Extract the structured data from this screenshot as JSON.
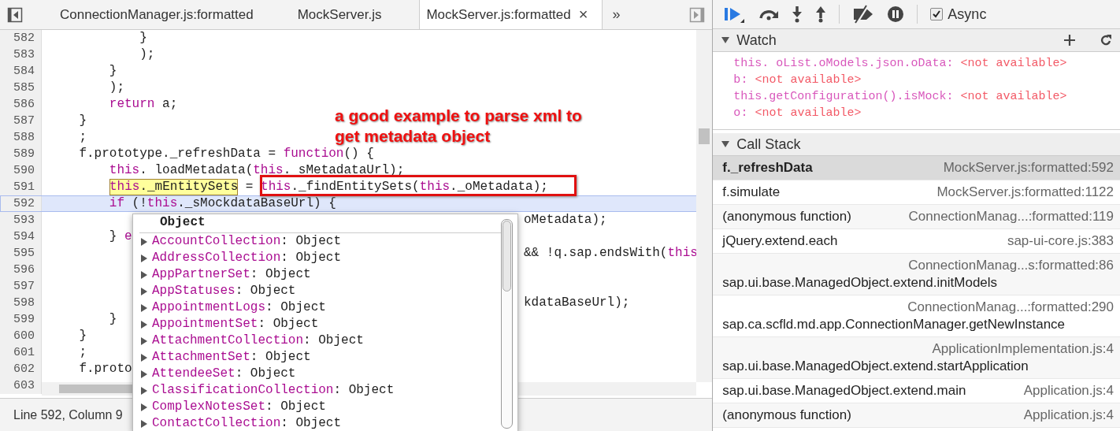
{
  "tabs": [
    {
      "label": "ConnectionManager.js:formatted",
      "selected": false
    },
    {
      "label": "MockServer.js",
      "selected": false
    },
    {
      "label": "MockServer.js:formatted",
      "selected": true,
      "close": "×"
    }
  ],
  "more_tabs": "»",
  "editor": {
    "lines": [
      {
        "num": "582",
        "selected": false,
        "segs": [
          {
            "t": "            }",
            "kind": "plain"
          }
        ]
      },
      {
        "num": "583",
        "selected": false,
        "segs": [
          {
            "t": "            );",
            "kind": "plain"
          }
        ]
      },
      {
        "num": "584",
        "selected": false,
        "segs": [
          {
            "t": "        }",
            "kind": "plain"
          }
        ]
      },
      {
        "num": "585",
        "selected": false,
        "segs": [
          {
            "t": "        );",
            "kind": "plain"
          }
        ]
      },
      {
        "num": "586",
        "selected": false,
        "segs": [
          {
            "t": "        return",
            "kind": "kw"
          },
          {
            "t": " a;",
            "kind": "plain"
          }
        ]
      },
      {
        "num": "587",
        "selected": false,
        "segs": [
          {
            "t": "    }",
            "kind": "plain"
          }
        ]
      },
      {
        "num": "588",
        "selected": false,
        "segs": [
          {
            "t": "    ;",
            "kind": "plain"
          }
        ]
      },
      {
        "num": "589",
        "selected": false,
        "segs": [
          {
            "t": "    f.prototype._refreshData = ",
            "kind": "plain"
          },
          {
            "t": "function",
            "kind": "kw"
          },
          {
            "t": "() {",
            "kind": "plain"
          }
        ]
      },
      {
        "num": "590",
        "selected": false,
        "segs": [
          {
            "t": "        this",
            "kind": "kw"
          },
          {
            "t": ". loadMetadata(",
            "kind": "plain"
          },
          {
            "t": "this",
            "kind": "kw"
          },
          {
            "t": ". sMetadataUrl);",
            "kind": "plain"
          }
        ]
      },
      {
        "num": "591",
        "selected": false,
        "indented": true,
        "segs": [
          {
            "kind": "marked",
            "segs": [
              {
                "t": "this",
                "kind": "kw"
              },
              {
                "t": "._mEntitySets",
                "kind": "plain"
              }
            ]
          },
          {
            "t": " = ",
            "kind": "plain"
          },
          {
            "t": "this",
            "kind": "kw"
          },
          {
            "t": "._findEntitySets(",
            "kind": "plain"
          },
          {
            "t": "this",
            "kind": "kw"
          },
          {
            "t": "._oMetadata);",
            "kind": "plain"
          }
        ]
      },
      {
        "num": "592",
        "selected": true,
        "segs": [
          {
            "t": "        if",
            "kind": "kw"
          },
          {
            "t": " (!",
            "kind": "plain"
          },
          {
            "t": "this",
            "kind": "kw"
          },
          {
            "t": "._sMockdataBaseUrl) {",
            "kind": "plain"
          }
        ]
      },
      {
        "num": "593",
        "selected": false,
        "tail": [
          {
            "t": "oMetadata);",
            "kind": "plain"
          }
        ]
      },
      {
        "num": "594",
        "selected": false,
        "segs": [
          {
            "t": "        } ",
            "kind": "plain"
          },
          {
            "t": "e",
            "kind": "kw"
          }
        ]
      },
      {
        "num": "595",
        "selected": false,
        "tail": [
          {
            "t": "&& !q.sap.endsWith(",
            "kind": "plain"
          },
          {
            "t": "this",
            "kind": "kw"
          }
        ]
      },
      {
        "num": "596",
        "selected": false
      },
      {
        "num": "597",
        "selected": false
      },
      {
        "num": "598",
        "selected": false,
        "tail": [
          {
            "t": "kdataBaseUrl);",
            "kind": "plain"
          }
        ]
      },
      {
        "num": "599",
        "selected": false,
        "segs": [
          {
            "t": "        }",
            "kind": "plain"
          }
        ]
      },
      {
        "num": "600",
        "selected": false,
        "segs": [
          {
            "t": "    }",
            "kind": "plain"
          }
        ]
      },
      {
        "num": "601",
        "selected": false,
        "segs": [
          {
            "t": "    ;",
            "kind": "plain"
          }
        ]
      },
      {
        "num": "602",
        "selected": false,
        "segs": [
          {
            "t": "    f.proto",
            "kind": "plain"
          }
        ]
      },
      {
        "num": "603",
        "selected": false
      }
    ],
    "annotation": "a good example to parse xml to get metadata object",
    "popup": {
      "title": "Object",
      "items": [
        {
          "key": "AccountCollection",
          "sep": ":",
          "value": "Object"
        },
        {
          "key": "AddressCollection",
          "sep": ":",
          "value": "Object"
        },
        {
          "key": "AppPartnerSet",
          "sep": ":",
          "value": "Object"
        },
        {
          "key": "AppStatuses",
          "sep": ":",
          "value": "Object"
        },
        {
          "key": "AppointmentLogs",
          "sep": ":",
          "value": "Object"
        },
        {
          "key": "AppointmentSet",
          "sep": ":",
          "value": "Object"
        },
        {
          "key": "AttachmentCollection",
          "sep": ":",
          "value": "Object"
        },
        {
          "key": "AttachmentSet",
          "sep": ":",
          "value": "Object"
        },
        {
          "key": "AttendeeSet",
          "sep": ":",
          "value": "Object"
        },
        {
          "key": "ClassificationCollection",
          "sep": ":",
          "value": "Object"
        },
        {
          "key": "ComplexNotesSet",
          "sep": ":",
          "value": "Object"
        },
        {
          "key": "ContactCollection",
          "sep": ":",
          "value": "Object"
        }
      ]
    }
  },
  "status_bar": "Line 592, Column 9",
  "toolbar": {
    "async": {
      "label": "Async",
      "checked": true
    }
  },
  "watch": {
    "title": "Watch",
    "items": [
      {
        "expr": "this. oList.oModels.json.oData",
        "sep": ":",
        "value": "<not available>"
      },
      {
        "expr": "b",
        "sep": ":",
        "value": "<not available>"
      },
      {
        "expr": "this.getConfiguration().isMock",
        "sep": ":",
        "value": "<not available>"
      },
      {
        "expr": "o",
        "sep": ":",
        "value": "<not available>"
      }
    ]
  },
  "call_stack": {
    "title": "Call Stack",
    "frames": [
      {
        "name": "f._refreshData",
        "location": "MockServer.js:formatted:592",
        "selected": true
      },
      {
        "name": "f.simulate",
        "location": "MockServer.js:formatted:1122",
        "selected": false
      },
      {
        "name": "(anonymous function)",
        "location": "ConnectionManag...:formatted:119",
        "selected": false
      },
      {
        "name": "jQuery.extend.each",
        "location": "sap-ui-core.js:383",
        "selected": false
      },
      {
        "name": "sap.ui.base.ManagedObject.extend.initModels",
        "location": "ConnectionManag...s:formatted:86",
        "selected": false
      },
      {
        "name": "sap.ca.scfld.md.app.ConnectionManager.getNewInstance",
        "location": "ConnectionManag...:formatted:290",
        "selected": false
      },
      {
        "name": "sap.ui.base.ManagedObject.extend.startApplication",
        "location": "ApplicationImplementation.js:4",
        "selected": false
      },
      {
        "name": "sap.ui.base.ManagedObject.extend.main",
        "location": "Application.js:4",
        "selected": false
      },
      {
        "name": "(anonymous function)",
        "location": "Application.js:4",
        "selected": false
      }
    ]
  }
}
